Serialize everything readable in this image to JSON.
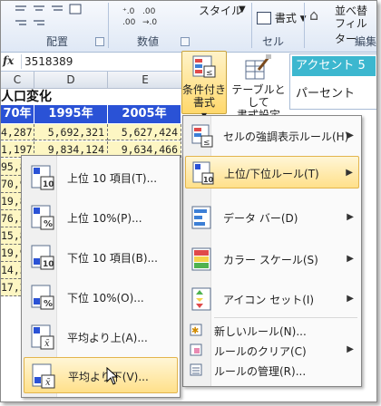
{
  "ribbon": {
    "style_label": "スタイル",
    "format_label": "書式",
    "sort_filter_line1": "並べ替",
    "sort_filter_line2": "フィルター",
    "groups": {
      "alignment": "配置",
      "number": "数値",
      "cells": "セル",
      "edit": "編集"
    }
  },
  "formula_bar": {
    "fx": "fx",
    "value": "3518389"
  },
  "columns": [
    "C",
    "D",
    "E"
  ],
  "sheet": {
    "title": "人口変化",
    "headers": [
      "70年",
      "1995年",
      "2005年"
    ],
    "rows": [
      [
        "4,287",
        "5,692,321",
        "5,627,424"
      ],
      [
        "1,197",
        "9,834,124",
        "9,634,466"
      ]
    ],
    "edge_values": [
      "95,8",
      "70,9",
      "19,8",
      "76,3",
      "15,8",
      "19,9",
      "14,3",
      "17,2"
    ]
  },
  "cf_button": {
    "line1": "条件付き",
    "line2": "書式"
  },
  "table_button": {
    "line1": "テーブルとして",
    "line2": "書式設定"
  },
  "style_gallery": {
    "accent": "アクセント 5",
    "percent": "パーセント"
  },
  "main_menu": {
    "items": [
      {
        "label": "セルの強調表示ルール(H)"
      },
      {
        "label": "上位/下位ルール(T)"
      },
      {
        "label": "データ バー(D)"
      },
      {
        "label": "カラー スケール(S)"
      },
      {
        "label": "アイコン セット(I)"
      }
    ],
    "small": [
      {
        "label": "新しいルール(N)..."
      },
      {
        "label": "ルールのクリア(C)"
      },
      {
        "label": "ルールの管理(R)..."
      }
    ]
  },
  "sub_menu": {
    "items": [
      {
        "label": "上位 10 項目(T)...",
        "badge": "10"
      },
      {
        "label": "上位 10%(P)...",
        "badge": "%"
      },
      {
        "label": "下位 10 項目(B)...",
        "badge": "10"
      },
      {
        "label": "下位 10%(O)...",
        "badge": "%"
      },
      {
        "label": "平均より上(A)...",
        "badge": "x̄"
      },
      {
        "label": "平均より下(V)...",
        "badge": "x̄"
      }
    ]
  },
  "colors": {
    "header_blue": "#2a52d6",
    "highlight": "#ffe08a",
    "accent5": "#3cb7cf",
    "cell_yellow": "#fdf6c3"
  }
}
